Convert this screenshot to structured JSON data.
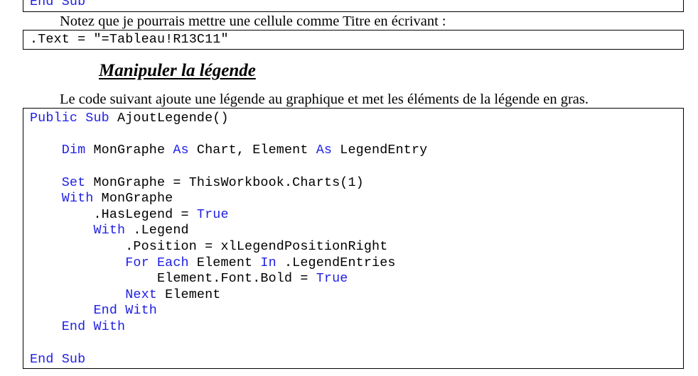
{
  "top_box": {
    "text": "End Sub"
  },
  "note_paragraph": "Notez que je pourrais mettre une cellule comme Titre en écrivant :",
  "text_box": {
    "code": ".Text = \"=Tableau!R13C11\""
  },
  "section_heading": "Manipuler la légende",
  "intro_paragraph": "Le code suivant ajoute une légende au graphique et met les éléments de la légende en gras.",
  "code_block": {
    "line1": {
      "kw1": "Public Sub",
      "t1": " AjoutLegende()"
    },
    "line3": {
      "indent": "    ",
      "kw1": "Dim",
      "t1": " MonGraphe ",
      "kw2": "As",
      "t2": " Chart, Element ",
      "kw3": "As",
      "t3": " LegendEntry"
    },
    "line5": {
      "indent": "    ",
      "kw1": "Set",
      "t1": " MonGraphe = ThisWorkbook.Charts(1)"
    },
    "line6": {
      "indent": "    ",
      "kw1": "With",
      "t1": " MonGraphe"
    },
    "line7": {
      "indent": "        ",
      "t1": ".HasLegend = ",
      "kw1": "True"
    },
    "line8": {
      "indent": "        ",
      "kw1": "With",
      "t1": " .Legend"
    },
    "line9": {
      "indent": "            ",
      "t1": ".Position = xlLegendPositionRight"
    },
    "line10": {
      "indent": "            ",
      "kw1": "For Each",
      "t1": " Element ",
      "kw2": "In",
      "t2": " .LegendEntries"
    },
    "line11": {
      "indent": "                ",
      "t1": "Element.Font.Bold = ",
      "kw1": "True"
    },
    "line12": {
      "indent": "            ",
      "kw1": "Next",
      "t1": " Element"
    },
    "line13": {
      "indent": "        ",
      "kw1": "End With"
    },
    "line14": {
      "indent": "    ",
      "kw1": "End With"
    },
    "line16": {
      "kw1": "End Sub"
    }
  },
  "colors": {
    "keyword": "#1f1fe6",
    "text": "#000000",
    "border": "#000000"
  }
}
